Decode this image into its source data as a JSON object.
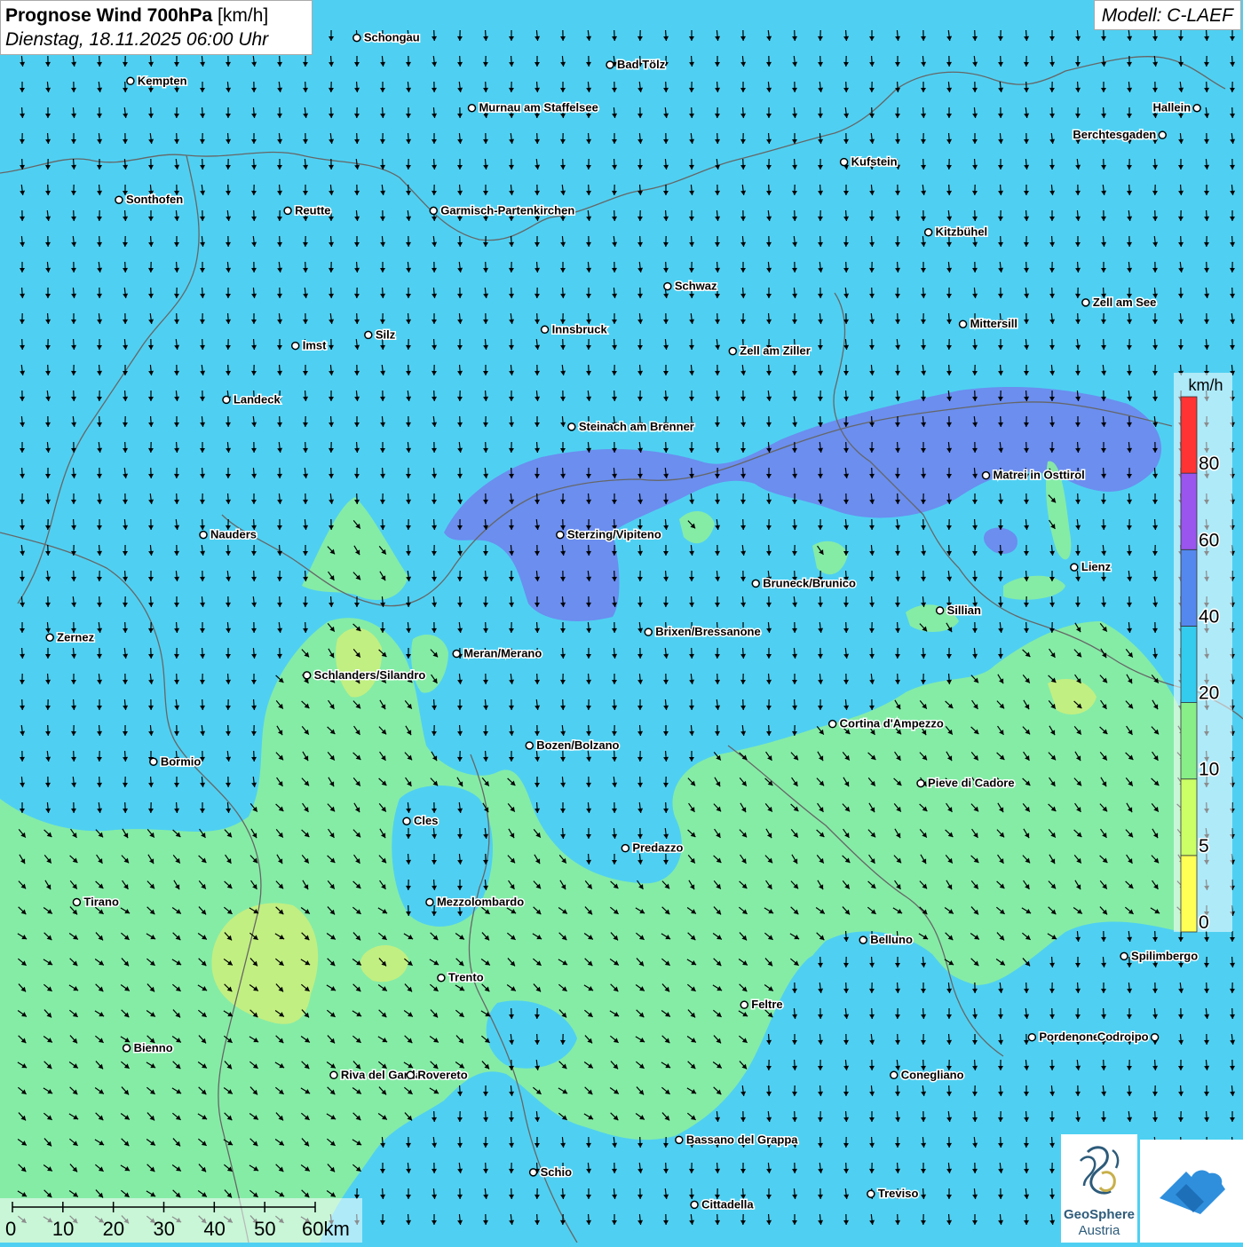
{
  "title": {
    "prefix": "Prognose Wind 700hPa",
    "unit": "[km/h]",
    "datetime": "Dienstag, 18.11.2025 06:00 Uhr"
  },
  "model": "Modell: C-LAEF",
  "legend": {
    "unit": "km/h",
    "classes": [
      {
        "label": "0",
        "color": "#ffff55"
      },
      {
        "label": "5",
        "color": "#ccff66"
      },
      {
        "label": "10",
        "color": "#88ee88"
      },
      {
        "label": "20",
        "color": "#33ccee"
      },
      {
        "label": "40",
        "color": "#5588ee"
      },
      {
        "label": "60",
        "color": "#9955ee"
      },
      {
        "label": "80",
        "color": "#ff3333"
      }
    ]
  },
  "scalebar": {
    "labels": [
      "0",
      "10",
      "20",
      "30",
      "40",
      "50",
      "60km"
    ]
  },
  "logo": {
    "name": "GeoSphere",
    "sub": "Austria"
  },
  "colors": {
    "calm": "#ccff66",
    "light": "#88ee88",
    "moderate": "#4fd0f2",
    "strong": "#6e86ee",
    "border": "#666666",
    "logo_blue": "#2f8fdd"
  },
  "places": [
    {
      "name": "Schongau",
      "lon": 10.9,
      "lat": 47.81
    },
    {
      "name": "Bad Tölz",
      "lon": 11.56,
      "lat": 47.76
    },
    {
      "name": "Kempten",
      "lon": 10.31,
      "lat": 47.73
    },
    {
      "name": "Murnau am Staffelsee",
      "lon": 11.2,
      "lat": 47.68
    },
    {
      "name": "Hallein",
      "lon": 13.09,
      "lat": 47.68
    },
    {
      "name": "Berchtesgaden",
      "lon": 13.0,
      "lat": 47.63
    },
    {
      "name": "Kufstein",
      "lon": 12.17,
      "lat": 47.58
    },
    {
      "name": "Sonthofen",
      "lon": 10.28,
      "lat": 47.51
    },
    {
      "name": "Reutte",
      "lon": 10.72,
      "lat": 47.49
    },
    {
      "name": "Garmisch-Partenkirchen",
      "lon": 11.1,
      "lat": 47.49
    },
    {
      "name": "Kitzbühel",
      "lon": 12.39,
      "lat": 47.45
    },
    {
      "name": "Schwaz",
      "lon": 11.71,
      "lat": 47.35
    },
    {
      "name": "Zell am See",
      "lon": 12.8,
      "lat": 47.32
    },
    {
      "name": "Mittersill",
      "lon": 12.48,
      "lat": 47.28
    },
    {
      "name": "Innsbruck",
      "lon": 11.39,
      "lat": 47.27
    },
    {
      "name": "Silz",
      "lon": 10.93,
      "lat": 47.26
    },
    {
      "name": "Imst",
      "lon": 10.74,
      "lat": 47.24
    },
    {
      "name": "Zell am Ziller",
      "lon": 11.88,
      "lat": 47.23
    },
    {
      "name": "Landeck",
      "lon": 10.56,
      "lat": 47.14
    },
    {
      "name": "Steinach am Brenner",
      "lon": 11.46,
      "lat": 47.09
    },
    {
      "name": "Matrei in Osttirol",
      "lon": 12.54,
      "lat": 47.0
    },
    {
      "name": "Nauders",
      "lon": 10.5,
      "lat": 46.89
    },
    {
      "name": "Sterzing/Vipiteno",
      "lon": 11.43,
      "lat": 46.89
    },
    {
      "name": "Lienz",
      "lon": 12.77,
      "lat": 46.83
    },
    {
      "name": "Bruneck/Brunico",
      "lon": 11.94,
      "lat": 46.8
    },
    {
      "name": "Sillian",
      "lon": 12.42,
      "lat": 46.75
    },
    {
      "name": "Brixen/Bressanone",
      "lon": 11.66,
      "lat": 46.71
    },
    {
      "name": "Zernez",
      "lon": 10.1,
      "lat": 46.7
    },
    {
      "name": "Meran/Merano",
      "lon": 11.16,
      "lat": 46.67
    },
    {
      "name": "Schlanders/Silandro",
      "lon": 10.77,
      "lat": 46.63
    },
    {
      "name": "Cortina d'Ampezzo",
      "lon": 12.14,
      "lat": 46.54
    },
    {
      "name": "Bozen/Bolzano",
      "lon": 11.35,
      "lat": 46.5
    },
    {
      "name": "Bormio",
      "lon": 10.37,
      "lat": 46.47
    },
    {
      "name": "Pieve di Cadore",
      "lon": 12.37,
      "lat": 46.43
    },
    {
      "name": "Cles",
      "lon": 11.03,
      "lat": 46.36
    },
    {
      "name": "Predazzo",
      "lon": 11.6,
      "lat": 46.31
    },
    {
      "name": "Tirano",
      "lon": 10.17,
      "lat": 46.21
    },
    {
      "name": "Mezzolombardo",
      "lon": 11.09,
      "lat": 46.21
    },
    {
      "name": "Belluno",
      "lon": 12.22,
      "lat": 46.14
    },
    {
      "name": "Spilimbergo",
      "lon": 12.9,
      "lat": 46.11
    },
    {
      "name": "Trento",
      "lon": 11.12,
      "lat": 46.07
    },
    {
      "name": "Feltre",
      "lon": 11.91,
      "lat": 46.02
    },
    {
      "name": "Pordenone",
      "lon": 12.66,
      "lat": 45.96
    },
    {
      "name": "Codroipo",
      "lon": 12.98,
      "lat": 45.96
    },
    {
      "name": "Bienno",
      "lon": 10.3,
      "lat": 45.94
    },
    {
      "name": "Riva del Garda",
      "lon": 10.84,
      "lat": 45.89
    },
    {
      "name": "Rovereto",
      "lon": 11.04,
      "lat": 45.89
    },
    {
      "name": "Conegliano",
      "lon": 12.3,
      "lat": 45.89
    },
    {
      "name": "Bassano del Grappa",
      "lon": 11.74,
      "lat": 45.77
    },
    {
      "name": "Schio",
      "lon": 11.36,
      "lat": 45.71
    },
    {
      "name": "Cittadella",
      "lon": 11.78,
      "lat": 45.65
    },
    {
      "name": "Treviso",
      "lon": 12.24,
      "lat": 45.67
    }
  ]
}
